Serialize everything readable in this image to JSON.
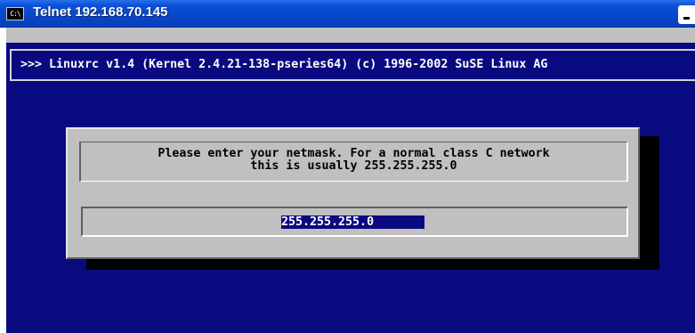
{
  "window": {
    "title": "Telnet 192.168.70.145",
    "icon": "console-icon",
    "icon_text": "C:\\"
  },
  "console": {
    "header": ">>> Linuxrc v1.4 (Kernel 2.4.21-138-pseries64) (c) 1996-2002 SuSE Linux AG"
  },
  "dialog": {
    "message_line_1": "Please enter your netmask. For a normal class C network",
    "message_line_2": "this is usually 255.255.255.0",
    "input_value": "255.255.255.0"
  },
  "colors": {
    "console_background": "#0a0a80",
    "dialog_background": "#c0c0c0",
    "input_highlight": "#0a0a80",
    "titlebar": "#0846c8"
  }
}
